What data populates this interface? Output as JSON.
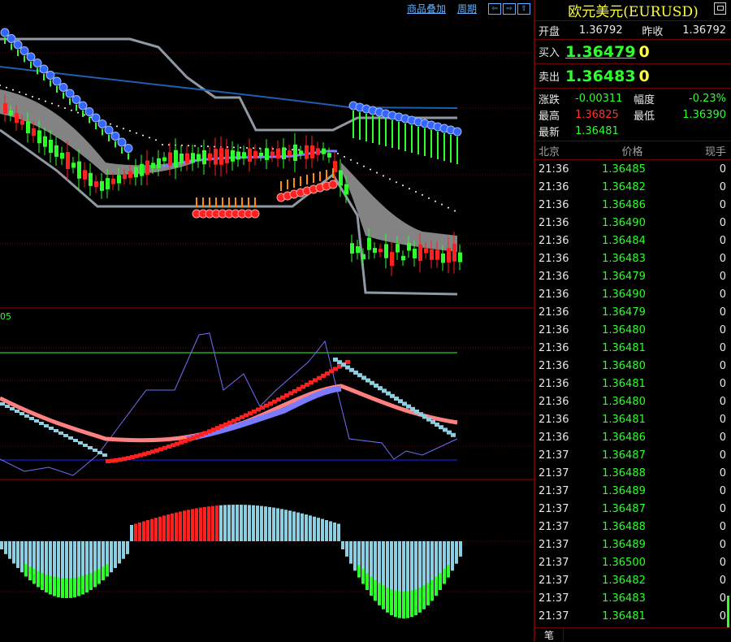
{
  "toolbar": {
    "overlay_label": "商品叠加",
    "period_label": "周期"
  },
  "indicator_label": "05",
  "colors": {
    "up": "#ff2020",
    "down": "#2cff2c",
    "grid": "#7a0000",
    "band": "#8f99a3",
    "macd_light": "#8ccfe0",
    "accent_yellow": "#ffff3c"
  },
  "quote": {
    "title": "欧元美元(EURUSD)",
    "open_label": "开盘",
    "open": "1.36792",
    "prev_close_label": "昨收",
    "prev_close": "1.36792",
    "buy_label": "买入",
    "buy_price": "1.36479",
    "buy_count": "0",
    "sell_label": "卖出",
    "sell_price": "1.36483",
    "sell_count": "0",
    "change_label": "涨跌",
    "change": "-0.00311",
    "pct_label": "幅度",
    "pct": "-0.23%",
    "high_label": "最高",
    "high": "1.36825",
    "low_label": "最低",
    "low": "1.36390",
    "last_label": "最新",
    "last": "1.36481"
  },
  "ticks": {
    "headers": [
      "北京",
      "价格",
      "现手"
    ],
    "rows": [
      {
        "time": "21:36",
        "price": "1.36485",
        "vol": "0"
      },
      {
        "time": "21:36",
        "price": "1.36482",
        "vol": "0"
      },
      {
        "time": "21:36",
        "price": "1.36486",
        "vol": "0"
      },
      {
        "time": "21:36",
        "price": "1.36490",
        "vol": "0"
      },
      {
        "time": "21:36",
        "price": "1.36484",
        "vol": "0"
      },
      {
        "time": "21:36",
        "price": "1.36483",
        "vol": "0"
      },
      {
        "time": "21:36",
        "price": "1.36479",
        "vol": "0"
      },
      {
        "time": "21:36",
        "price": "1.36490",
        "vol": "0"
      },
      {
        "time": "21:36",
        "price": "1.36479",
        "vol": "0"
      },
      {
        "time": "21:36",
        "price": "1.36480",
        "vol": "0"
      },
      {
        "time": "21:36",
        "price": "1.36481",
        "vol": "0"
      },
      {
        "time": "21:36",
        "price": "1.36480",
        "vol": "0"
      },
      {
        "time": "21:36",
        "price": "1.36481",
        "vol": "0"
      },
      {
        "time": "21:36",
        "price": "1.36480",
        "vol": "0"
      },
      {
        "time": "21:36",
        "price": "1.36481",
        "vol": "0"
      },
      {
        "time": "21:36",
        "price": "1.36486",
        "vol": "0"
      },
      {
        "time": "21:37",
        "price": "1.36487",
        "vol": "0"
      },
      {
        "time": "21:37",
        "price": "1.36488",
        "vol": "0"
      },
      {
        "time": "21:37",
        "price": "1.36489",
        "vol": "0"
      },
      {
        "time": "21:37",
        "price": "1.36487",
        "vol": "0"
      },
      {
        "time": "21:37",
        "price": "1.36488",
        "vol": "0"
      },
      {
        "time": "21:37",
        "price": "1.36489",
        "vol": "0"
      },
      {
        "time": "21:37",
        "price": "1.36500",
        "vol": "0"
      },
      {
        "time": "21:37",
        "price": "1.36482",
        "vol": "0"
      },
      {
        "time": "21:37",
        "price": "1.36483",
        "vol": "0"
      },
      {
        "time": "21:37",
        "price": "1.36481",
        "vol": "0"
      }
    ]
  },
  "tabs": [
    "笔"
  ]
}
